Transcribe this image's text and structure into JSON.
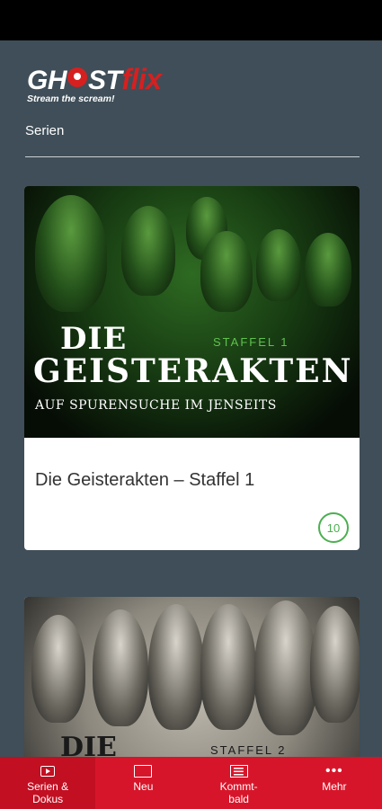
{
  "header": {
    "logo_ghost": "GH",
    "logo_st": "ST",
    "logo_flix": "flix",
    "tagline": "Stream the scream!",
    "section_title": "Serien"
  },
  "cards": [
    {
      "poster_die": "DIE",
      "poster_title": "GEISTERAKTEN",
      "poster_staffel": "STAFFEL 1",
      "poster_subtitle": "AUF SPURENSUCHE IM JENSEITS",
      "title": "Die Geisterakten – Staffel 1",
      "count": "10"
    },
    {
      "poster_die": "DIE",
      "poster_staffel": "STAFFEL 2"
    }
  ],
  "nav": [
    {
      "label": "Serien &\nDokus",
      "icon": "tv-play-icon"
    },
    {
      "label": "Neu",
      "icon": "screen-icon"
    },
    {
      "label": "Kommt-\nbald",
      "icon": "news-icon"
    },
    {
      "label": "Mehr",
      "icon": "more-dots-icon"
    }
  ],
  "colors": {
    "background": "#3f4e58",
    "accent": "#d7152a",
    "badge": "#4caf50"
  }
}
